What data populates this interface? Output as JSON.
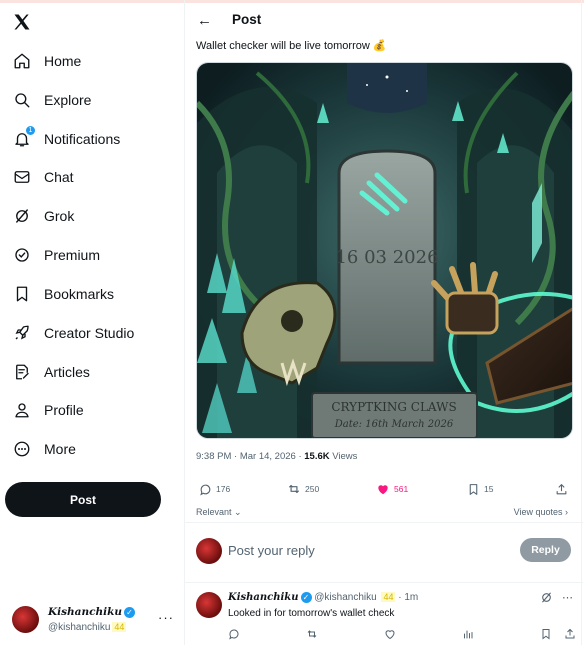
{
  "colors": {
    "accent": "#1d9bf0",
    "like": "#f91880",
    "text": "#0f1419",
    "muted": "#536471"
  },
  "sidebar": {
    "logo": "x-logo-icon",
    "items": [
      {
        "label": "Home",
        "icon": "home-icon"
      },
      {
        "label": "Explore",
        "icon": "search-icon"
      },
      {
        "label": "Notifications",
        "icon": "bell-icon",
        "badge": "1"
      },
      {
        "label": "Chat",
        "icon": "mail-icon"
      },
      {
        "label": "Grok",
        "icon": "grok-icon"
      },
      {
        "label": "Premium",
        "icon": "verified-icon"
      },
      {
        "label": "Bookmarks",
        "icon": "bookmark-icon"
      },
      {
        "label": "Creator Studio",
        "icon": "rocket-icon"
      },
      {
        "label": "Articles",
        "icon": "article-icon"
      },
      {
        "label": "Profile",
        "icon": "person-icon"
      },
      {
        "label": "More",
        "icon": "more-circle-icon"
      }
    ],
    "post_button": "Post",
    "account": {
      "name": "Kishanchiku",
      "handle": "@kishanchiku",
      "tag": "44",
      "more": "···"
    }
  },
  "header": {
    "back": "←",
    "title": "Post"
  },
  "tweet": {
    "text": "Wallet checker will be live tomorrow 💰",
    "image": {
      "date_on_stone": "16 03 2026",
      "plaque_title": "CRYPTKING CLAWS",
      "plaque_date": "Date: 16th March 2026"
    },
    "time": "9:38 PM · Mar 14, 2026 · ",
    "views_count": "15.6K",
    "views_label": " Views",
    "stats": {
      "replies": "176",
      "reposts": "250",
      "likes": "561",
      "bookmarks": "15"
    },
    "relevant": "Relevant",
    "view_quotes": "View quotes"
  },
  "composer": {
    "placeholder": "Post your reply",
    "reply_button": "Reply"
  },
  "reply": {
    "name": "Kishanchiku",
    "handle": "@kishanchiku",
    "tag": "44",
    "time": "· 1m",
    "text": "Looked in for tomorrow's wallet check"
  }
}
